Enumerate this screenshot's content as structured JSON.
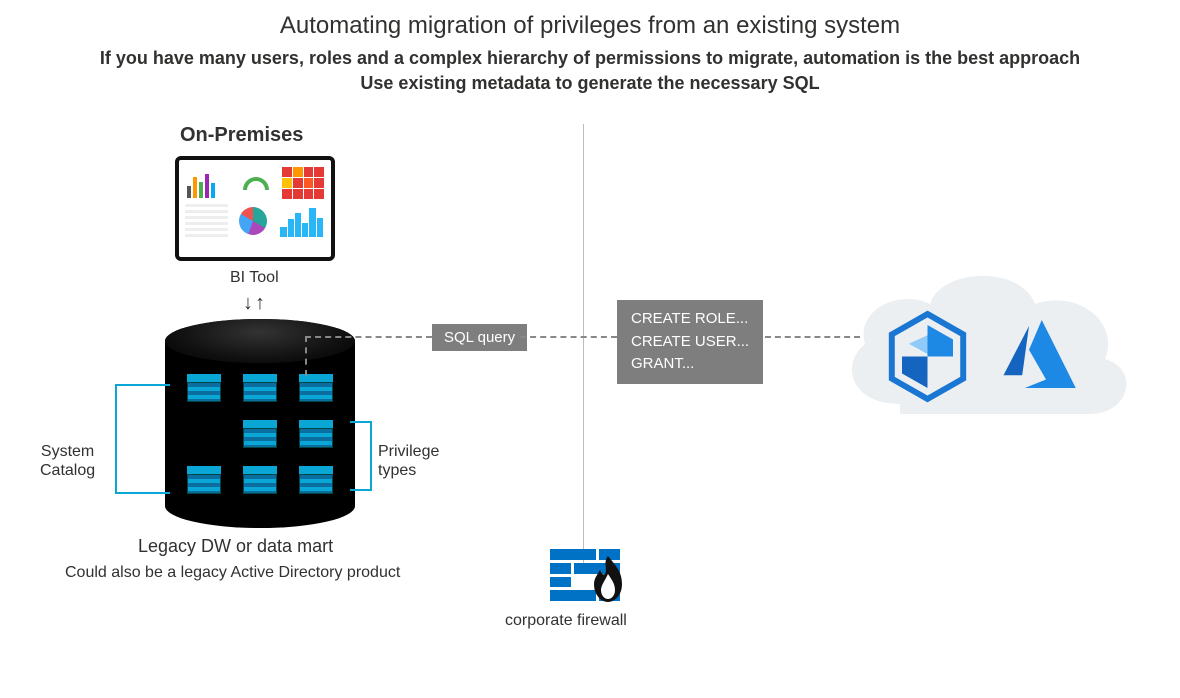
{
  "title": "Automating migration of privileges from an existing system",
  "subtitle1": "If you have many users, roles and a complex hierarchy of permissions to migrate, automation is the best approach",
  "subtitle2": "Use existing metadata to generate the necessary SQL",
  "onprem": {
    "heading": "On-Premises",
    "bi_tool_label": "BI Tool",
    "system_catalog_label": "System\nCatalog",
    "privilege_types_label": "Privilege\ntypes",
    "legacy_label": "Legacy DW or data mart",
    "legacy_sub": "Could also be a legacy Active Directory product"
  },
  "flow": {
    "sql_query_label": "SQL query",
    "statements": {
      "line1": "CREATE ROLE...",
      "line2": "CREATE USER...",
      "line3": "GRANT..."
    }
  },
  "firewall": {
    "label": "corporate firewall"
  },
  "cloud": {
    "synapse_name": "azure-synapse-icon",
    "azure_name": "azure-logo-icon"
  }
}
